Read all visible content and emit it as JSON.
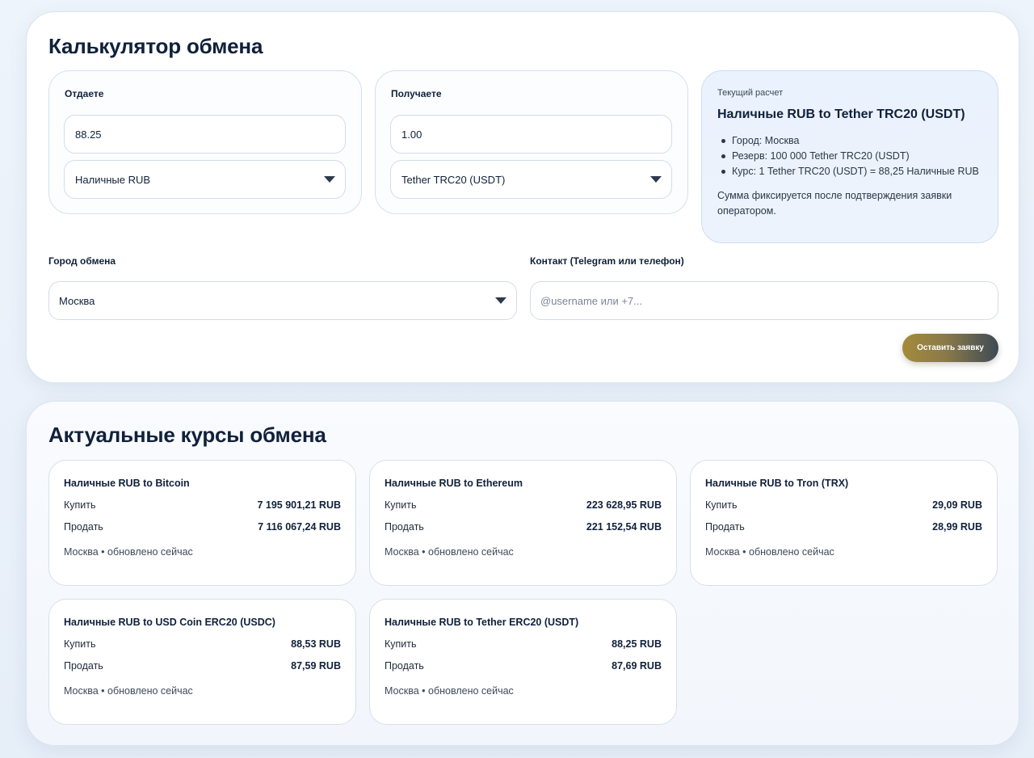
{
  "calculator": {
    "title": "Калькулятор обмена",
    "give": {
      "label": "Отдаете",
      "amount": "88.25",
      "currency": "Наличные RUB"
    },
    "get": {
      "label": "Получаете",
      "amount": "1.00",
      "currency": "Tether TRC20 (USDT)"
    },
    "summary": {
      "kicker": "Текущий расчет",
      "title": "Наличные RUB to Tether TRC20 (USDT)",
      "items": [
        "Город: Москва",
        "Резерв: 100 000 Tether TRC20 (USDT)",
        "Курс: 1 Tether TRC20 (USDT) = 88,25 Наличные RUB"
      ],
      "note": "Сумма фиксируется после подтверждения заявки оператором."
    },
    "city": {
      "label": "Город обмена",
      "value": "Москва"
    },
    "contact": {
      "label": "Контакт (Telegram или телефон)",
      "placeholder": "@username или +7..."
    },
    "submit_label": "Оставить заявку"
  },
  "rates": {
    "title": "Актуальные курсы обмена",
    "buy_label": "Купить",
    "sell_label": "Продать",
    "cards": [
      {
        "title": "Наличные RUB to Bitcoin",
        "buy": "7 195 901,21 RUB",
        "sell": "7 116 067,24 RUB",
        "footer": "Москва • обновлено сейчас"
      },
      {
        "title": "Наличные RUB to Ethereum",
        "buy": "223 628,95 RUB",
        "sell": "221 152,54 RUB",
        "footer": "Москва • обновлено сейчас"
      },
      {
        "title": "Наличные RUB to Tron (TRX)",
        "buy": "29,09 RUB",
        "sell": "28,99 RUB",
        "footer": "Москва • обновлено сейчас"
      },
      {
        "title": "Наличные RUB to USD Coin ERC20 (USDC)",
        "buy": "88,53 RUB",
        "sell": "87,59 RUB",
        "footer": "Москва • обновлено сейчас"
      },
      {
        "title": "Наличные RUB to Tether ERC20 (USDT)",
        "buy": "88,25 RUB",
        "sell": "87,69 RUB",
        "footer": "Москва • обновлено сейчас"
      }
    ]
  }
}
